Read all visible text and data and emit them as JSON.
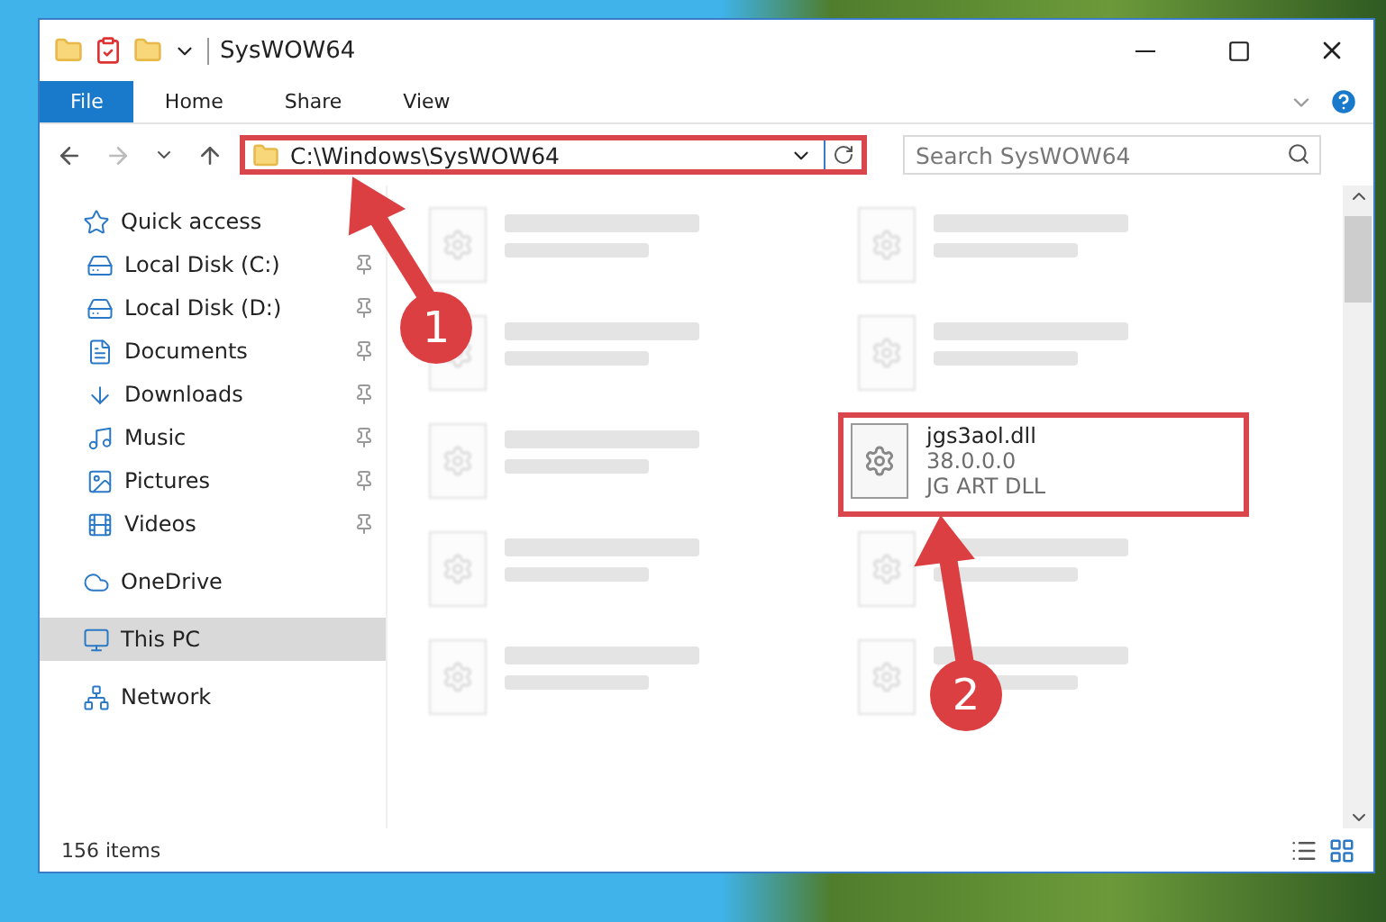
{
  "window": {
    "title": "SysWOW64"
  },
  "ribbon_tabs": [
    {
      "label": "File",
      "selected": true
    },
    {
      "label": "Home",
      "selected": false
    },
    {
      "label": "Share",
      "selected": false
    },
    {
      "label": "View",
      "selected": false
    }
  ],
  "address": {
    "path": "C:\\Windows\\SysWOW64",
    "annotated": true
  },
  "search": {
    "placeholder": "Search SysWOW64"
  },
  "sidebar": [
    {
      "label": "Quick access",
      "selected": false,
      "children": [
        {
          "label": "Local Disk (C:)",
          "pinned": true,
          "selected": false
        },
        {
          "label": "Local Disk (D:)",
          "pinned": true,
          "selected": false
        },
        {
          "label": "Documents",
          "pinned": true,
          "selected": false
        },
        {
          "label": "Downloads",
          "pinned": true,
          "selected": false
        },
        {
          "label": "Music",
          "pinned": true,
          "selected": false
        },
        {
          "label": "Pictures",
          "pinned": true,
          "selected": false
        },
        {
          "label": "Videos",
          "pinned": true,
          "selected": false
        }
      ]
    },
    {
      "label": "OneDrive",
      "selected": false
    },
    {
      "label": "This PC",
      "selected": true
    },
    {
      "label": "Network",
      "selected": false
    }
  ],
  "files": [
    {
      "kind": "blurred",
      "annotated": false
    },
    {
      "kind": "blurred",
      "annotated": false
    },
    {
      "kind": "blurred",
      "annotated": false
    },
    {
      "kind": "blurred",
      "annotated": false
    },
    {
      "kind": "blurred",
      "annotated": false
    },
    {
      "name": "jgs3aol.dll",
      "lines": [
        "38.0.0.0",
        "JG ART DLL"
      ],
      "kind": "clear",
      "annotated": true
    },
    {
      "kind": "blurred",
      "annotated": false
    },
    {
      "kind": "blurred",
      "annotated": false
    },
    {
      "kind": "blurred",
      "annotated": false
    },
    {
      "kind": "blurred",
      "annotated": false
    }
  ],
  "status_bar": {
    "count": "156 items"
  },
  "annotations": [
    {
      "number": "1"
    },
    {
      "number": "2"
    }
  ]
}
